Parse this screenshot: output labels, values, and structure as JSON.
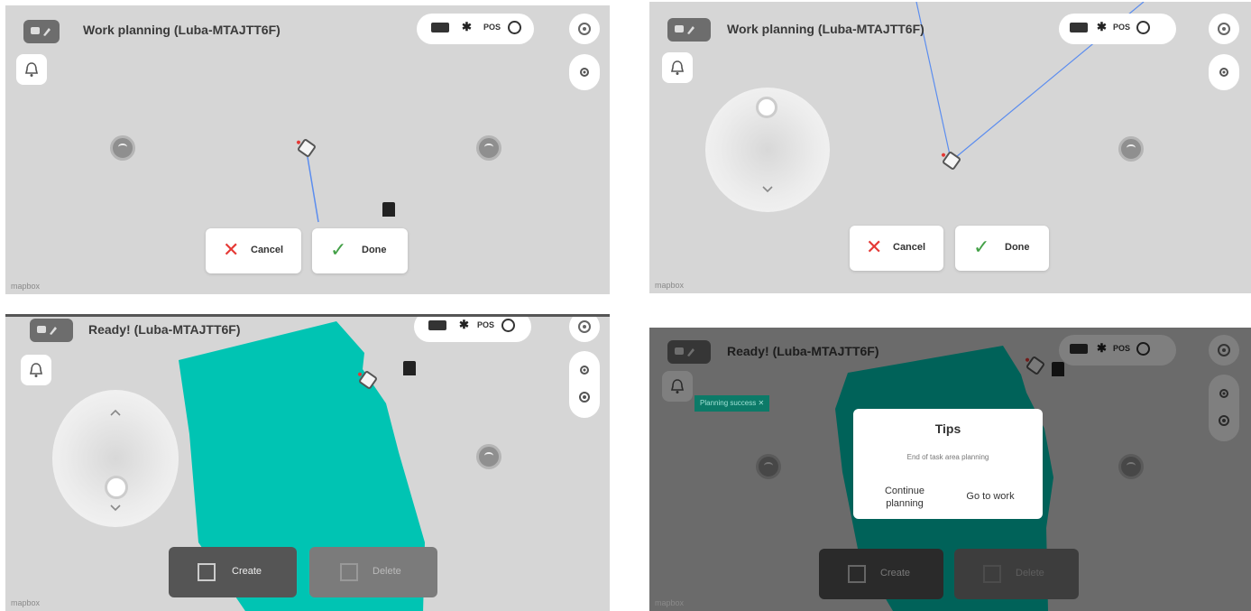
{
  "panels": [
    {
      "title": "Work planning (Luba-MTAJTT6F)",
      "status": {
        "pos": "POS"
      },
      "buttons": {
        "cancel": "Cancel",
        "done": "Done"
      },
      "watermark": "mapbox"
    },
    {
      "title": "Work planning (Luba-MTAJTT6F)",
      "status": {
        "pos": "POS"
      },
      "buttons": {
        "cancel": "Cancel",
        "done": "Done"
      },
      "watermark": "mapbox"
    },
    {
      "title": "Ready! (Luba-MTAJTT6F)",
      "status": {
        "pos": "POS"
      },
      "buttons": {
        "create": "Create",
        "delete": "Delete"
      },
      "watermark": "mapbox",
      "area_color": "#00c4b3"
    },
    {
      "title": "Ready! (Luba-MTAJTT6F)",
      "status": {
        "pos": "POS"
      },
      "toast": "Planning success",
      "buttons": {
        "create": "Create",
        "delete": "Delete"
      },
      "dialog": {
        "title": "Tips",
        "message": "End of task area planning",
        "continue": "Continue planning",
        "go": "Go to work"
      },
      "watermark": "mapbox",
      "area_color": "#0b6a5c"
    }
  ],
  "icons": [
    "edit-icon",
    "bell-icon",
    "settings-icon",
    "locate-icon",
    "battery-icon",
    "bluetooth-icon",
    "rtk-icon",
    "close-icon",
    "check-icon",
    "create-icon",
    "delete-icon",
    "mower-icon",
    "station-icon"
  ],
  "colors": {
    "cancel_x": "#e53935",
    "done_check": "#43a047",
    "area_teal": "#00c4b3",
    "path_line": "#5b8def"
  }
}
